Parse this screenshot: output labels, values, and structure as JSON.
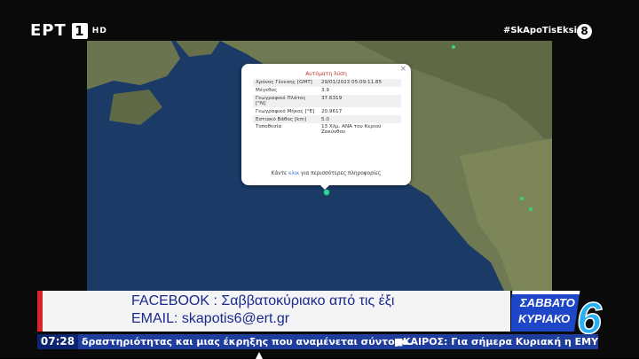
{
  "channel": {
    "name": "ΕΡΤ",
    "number": "1",
    "hd": "HD",
    "hashtag": "#SkApoTisEksi",
    "age_rating": "8"
  },
  "popup": {
    "close": "×",
    "title": "Αυτόματη λύση",
    "rows": [
      {
        "label": "Χρόνος Γένεσης [GMT]",
        "value": "29/01/2023 05:09:11.85"
      },
      {
        "label": "Μέγεθος",
        "value": "3.9"
      },
      {
        "label": "Γεωγραφικό Πλάτος [°N]",
        "value": "37.6319"
      },
      {
        "label": "Γεωγραφικό Μήκος [°E]",
        "value": "20.9617"
      },
      {
        "label": "Εστιακό Βάθος [km]",
        "value": "5.0"
      },
      {
        "label": "Τοποθεσία",
        "value": "13 Χλμ. ΑΝΑ του Κεριού Ζακύνθου"
      }
    ],
    "more_prefix": "Κάντε ",
    "more_link": "κλικ",
    "more_suffix": " για περισσότερες πληροφορίες"
  },
  "lower_third": {
    "line1": "FACEBOOK : Σαββατοκύριακο από τις έξι",
    "line2": "EMAIL: skapotis6@ert.gr"
  },
  "show_logo": {
    "line1": "ΣΑΒΒΑΤΟ",
    "line2": "ΚΥΡΙΑΚΟ",
    "number": "6"
  },
  "ticker": {
    "time": "07:28",
    "text": "δραστηριότητας και μιας έκρηξης που αναμένεται σύντομα.",
    "separator": "■",
    "text2": "ΚΑΙΡΟΣ: Για σήμερα Κυριακή η ΕΜΥ"
  },
  "colors": {
    "sea": "#1b3a66",
    "land": "#6f7a52",
    "popup_title": "#c0392b",
    "lower_third_text": "#1a2a8c",
    "accent_red": "#d6252b",
    "ticker_bg": "#1f3d9c"
  }
}
